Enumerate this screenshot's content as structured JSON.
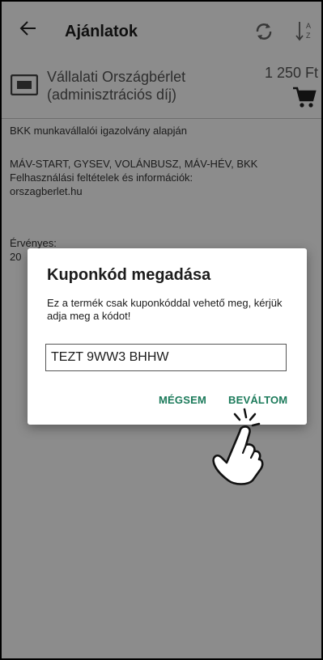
{
  "appbar": {
    "title": "Ajánlatok"
  },
  "product": {
    "name": "Vállalati Országbérlet (adminisztrációs díj)",
    "price": "1 250 Ft"
  },
  "info": {
    "line1": "BKK munkavállalói igazolvány alapján",
    "line2": "MÁV-START, GYSEV, VOLÁNBUSZ, MÁV-HÉV, BKK",
    "line3": "Felhasználási feltételek és információk:",
    "line4": "orszagberlet.hu",
    "valid_label": "Érvényes:",
    "valid_value": "20"
  },
  "dialog": {
    "title": "Kuponkód megadása",
    "message": "Ez a termék csak kuponkóddal vehető meg, kérjük adja meg a kódot!",
    "input_value": "TEZT 9WW3 BHHW",
    "cancel_label": "MÉGSEM",
    "confirm_label": "BEVÁLTOM"
  },
  "colors": {
    "accent": "#1b7a5a",
    "overlay": "rgba(0,0,0,0.45)"
  },
  "icons": [
    "back-arrow-icon",
    "refresh-icon",
    "sort-az-icon",
    "card-icon",
    "cart-icon",
    "hand-pointer-icon"
  ]
}
